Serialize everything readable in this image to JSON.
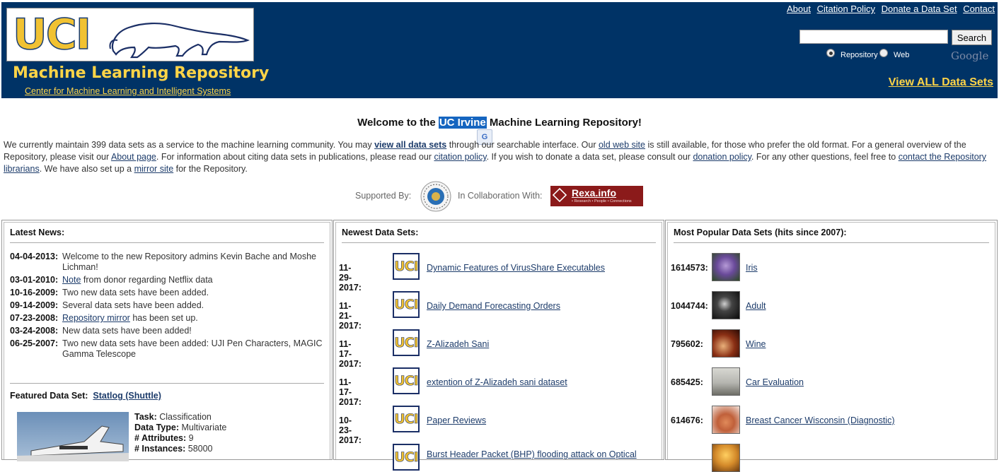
{
  "header": {
    "logo_text": "UCI",
    "title": "Machine Learning Repository",
    "subtitle": "Center for Machine Learning and Intelligent Systems",
    "top_links": [
      "About",
      "Citation Policy",
      "Donate a Data Set",
      "Contact"
    ],
    "search_button": "Search",
    "search_value": "",
    "radio_options": [
      {
        "label": "Repository",
        "checked": true
      },
      {
        "label": "Web",
        "checked": false
      }
    ],
    "google_text": "Google",
    "view_all": "View ALL Data Sets"
  },
  "intro": {
    "welcome_prefix": "Welcome to the ",
    "welcome_highlight": "UC Irvine",
    "welcome_suffix": " Machine Learning Repository!",
    "p1": "We currently maintain 399 data sets as a service to the machine learning community. You may ",
    "link_view_all": "view all data sets",
    "p2": " through our searchable interface. Our ",
    "link_old_site": "old web site",
    "p3": " is still available, for those who prefer the old format. For a general overview of the Repository, please visit our ",
    "link_about": "About page",
    "p4": ". For information about citing data sets in publications, please read our ",
    "link_citation": "citation policy",
    "p5": ". If you wish to donate a data set, please consult our ",
    "link_donation": "donation policy",
    "p6": ". For any other questions, feel free to ",
    "link_contact": "contact the Repository librarians",
    "p7": ". We have also set up a ",
    "link_mirror": "mirror site",
    "p8": " for the Repository.",
    "supported_by": "Supported By:",
    "collaboration": "In Collaboration With:",
    "rexa_name": "Rexa.info",
    "rexa_tagline": "• Research • People • Connections"
  },
  "news": {
    "title": "Latest News:",
    "items": [
      {
        "date": "04-04-2013:",
        "text": "Welcome to the new Repository admins Kevin Bache and Moshe Lichman!"
      },
      {
        "date": "03-01-2010:",
        "link": "Note",
        "text": " from donor regarding Netflix data"
      },
      {
        "date": "10-16-2009:",
        "text": "Two new data sets have been added."
      },
      {
        "date": "09-14-2009:",
        "text": "Several data sets have been added."
      },
      {
        "date": "07-23-2008:",
        "link": "Repository mirror",
        "text": " has been set up."
      },
      {
        "date": "03-24-2008:",
        "text": "New data sets have been added!"
      },
      {
        "date": "06-25-2007:",
        "text": "Two new data sets have been added: UJI Pen Characters, MAGIC Gamma Telescope"
      }
    ],
    "featured_label": "Featured Data Set:",
    "featured_name": "Statlog (Shuttle)",
    "featured": {
      "task_label": "Task:",
      "task": "Classification",
      "type_label": "Data Type:",
      "type": "Multivariate",
      "attr_label": "# Attributes:",
      "attrs": "9",
      "inst_label": "# Instances:",
      "instances": "58000"
    }
  },
  "newest": {
    "title": "Newest Data Sets:",
    "items": [
      {
        "date": "11-29-2017:",
        "name": "Dynamic Features of VirusShare Executables"
      },
      {
        "date": "11-21-2017:",
        "name": "Daily Demand Forecasting Orders"
      },
      {
        "date": "11-17-2017:",
        "name": "Z-Alizadeh Sani"
      },
      {
        "date": "11-17-2017:",
        "name": "extention of Z-Alizadeh sani dataset"
      },
      {
        "date": "10-23-2017:",
        "name": "Paper Reviews"
      },
      {
        "date": "",
        "name": "Burst Header Packet (BHP) flooding attack on Optical"
      }
    ],
    "icon_text": "UCI"
  },
  "popular": {
    "title": "Most Popular Data Sets (hits since 2007):",
    "items": [
      {
        "hits": "1614573:",
        "name": "Iris",
        "thumb_color": "#6a4a9a"
      },
      {
        "hits": "1044744:",
        "name": "Adult",
        "thumb_color": "#1a1a1a"
      },
      {
        "hits": "795602:",
        "name": "Wine",
        "thumb_color": "#8a2f14"
      },
      {
        "hits": "685425:",
        "name": "Car Evaluation",
        "thumb_color": "#b5b5b0"
      },
      {
        "hits": "614676:",
        "name": "Breast Cancer Wisconsin (Diagnostic)",
        "thumb_color": "#c0603a"
      },
      {
        "hits": "",
        "name": "",
        "thumb_color": "#d48a2a"
      }
    ]
  }
}
